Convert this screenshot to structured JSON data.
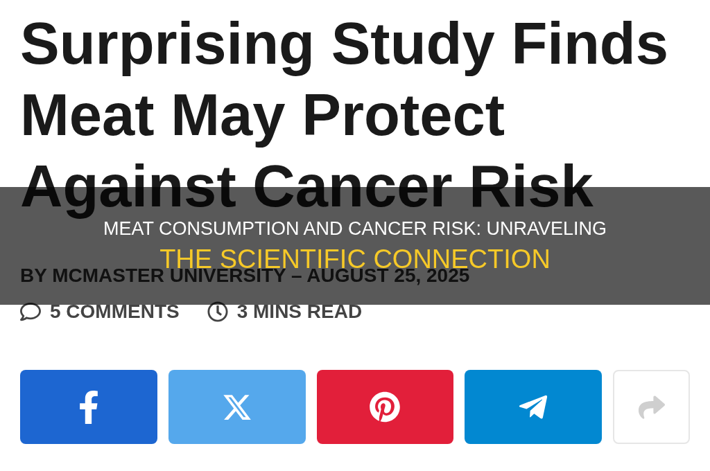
{
  "article": {
    "headline": "Surprising Study Finds Meat May Protect Against Cancer Risk",
    "byline": "BY MCMASTER UNIVERSITY – AUGUST 25, 2025",
    "meta": [
      {
        "kind": "comments",
        "text": "5 COMMENTS"
      },
      {
        "kind": "read_time",
        "text": "3 MINS READ"
      }
    ],
    "share_buttons": [
      {
        "kind": "facebook",
        "color": "#1d66d1"
      },
      {
        "kind": "x",
        "color": "#55a8ec"
      },
      {
        "kind": "pinterest",
        "color": "#e21f3a"
      },
      {
        "kind": "telegram",
        "color": "#0288d1"
      },
      {
        "kind": "share",
        "color": "#ffffff"
      }
    ]
  },
  "overlay": {
    "title_lines": [
      {
        "text": "MEAT CONSUMPTION AND CANCER RISK: UNRAVELING",
        "highlighted": false
      },
      {
        "text": "THE SCIENTIFIC CONNECTION",
        "highlighted": true
      }
    ]
  }
}
